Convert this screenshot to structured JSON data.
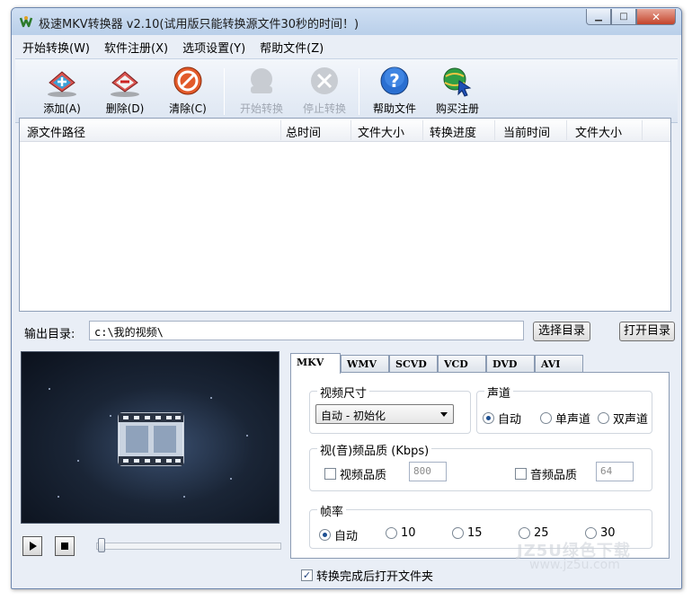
{
  "window": {
    "title": "极速MKV转换器 v2.10(试用版只能转换源文件30秒的时间！)",
    "controls": {
      "minimize": "▁",
      "maximize": "□",
      "close": "✕"
    }
  },
  "menu": [
    "开始转换(W)",
    "软件注册(X)",
    "选项设置(Y)",
    "帮助文件(Z)"
  ],
  "toolbar": {
    "add": "添加(A)",
    "delete": "删除(D)",
    "clear": "清除(C)",
    "start": "开始转换",
    "stop": "停止转换",
    "help": "帮助文件",
    "buy": "购买注册"
  },
  "filelist": {
    "columns": [
      "源文件路径",
      "总时间",
      "文件大小",
      "转换进度",
      "当前时间",
      "文件大小"
    ],
    "rows": []
  },
  "output": {
    "label": "输出目录:",
    "path": "c:\\我的视频\\",
    "choose_btn": "选择目录",
    "open_btn": "打开目录"
  },
  "tabs": [
    "MKV",
    "WMV",
    "SCVD",
    "VCD",
    "DVD",
    "AVI"
  ],
  "settings": {
    "video_size": {
      "title": "视频尺寸",
      "value": "自动 - 初始化"
    },
    "audio_channel": {
      "title": "声道",
      "options": [
        "自动",
        "单声道",
        "双声道"
      ],
      "selected": "自动"
    },
    "quality": {
      "title": "视(音)频品质 (Kbps)",
      "video_label": "视频品质",
      "video_value": "800",
      "audio_label": "音频品质",
      "audio_value": "64"
    },
    "framerate": {
      "title": "帧率",
      "options": [
        "自动",
        "10",
        "15",
        "25",
        "30"
      ],
      "selected": "自动"
    }
  },
  "open_after": {
    "label": "转换完成后打开文件夹",
    "checked": true
  },
  "watermark": {
    "line1": "JZ5U绿色下载",
    "line2": "www.jz5u.com"
  },
  "colors": {
    "accent": "#1d4f91",
    "titlebar": "#c5d8ef",
    "close": "#c3442b"
  }
}
